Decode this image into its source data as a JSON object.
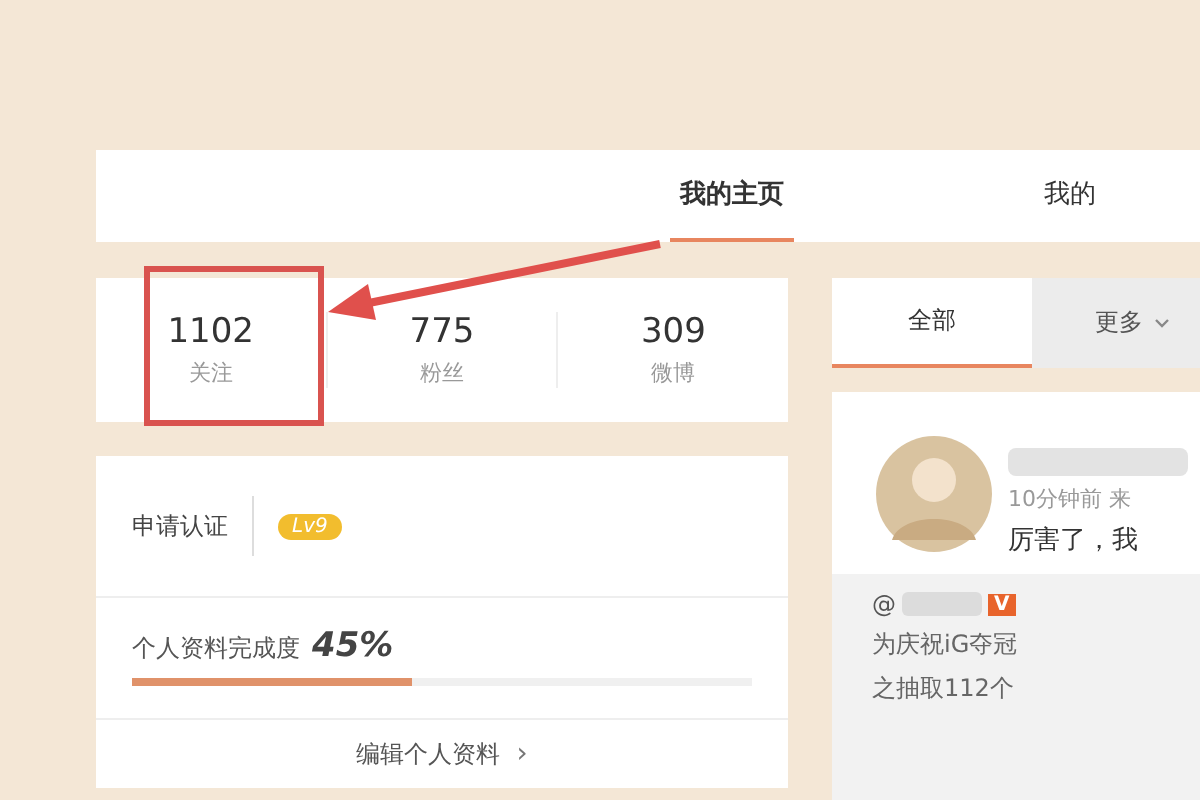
{
  "nav": {
    "tabs": [
      {
        "label": "我的主页",
        "selected": true
      },
      {
        "label": "我的",
        "selected": false
      }
    ]
  },
  "stats": [
    {
      "value": "1102",
      "label": "关注"
    },
    {
      "value": "775",
      "label": "粉丝"
    },
    {
      "value": "309",
      "label": "微博"
    }
  ],
  "profile": {
    "verify": "申请认证",
    "level_badge": "Lv9",
    "completion_label": "个人资料完成度",
    "completion_value": "45%",
    "level": 0.45,
    "edit_link": "编辑个人资料",
    "edit_chevron": "›"
  },
  "feed_tabs": [
    {
      "label": "全部",
      "selected": true
    },
    {
      "label": "更多",
      "selected": false
    }
  ],
  "post": {
    "time": "10分钟前 来",
    "text": "厉害了，我",
    "repost": {
      "at": "@",
      "badge": "V",
      "line_1": "为庆祝iG夺冠",
      "line_2": "之抽取112个"
    }
  }
}
